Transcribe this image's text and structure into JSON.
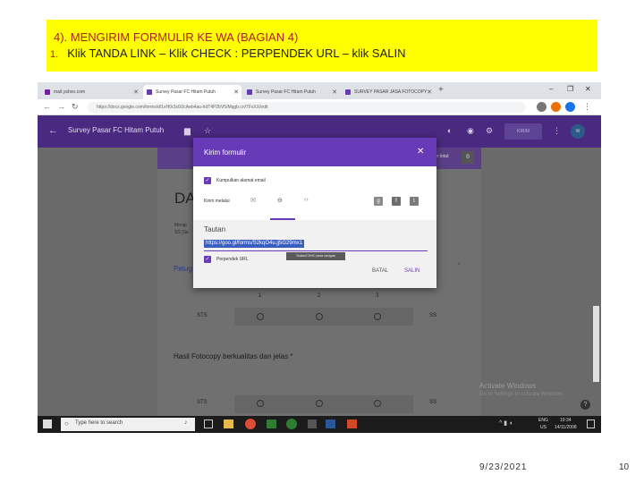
{
  "slide": {
    "heading_line1": "4). MENGIRIM FORMULIR KE WA (BAGIAN 4)",
    "list_number": "1.",
    "heading_line2": "Klik TANDA LINK – Klik CHECK : PERPENDEK URL – klik SALIN",
    "footer_date": "9/23/2021",
    "page_number": "10"
  },
  "browser": {
    "tabs": [
      {
        "label": "mail.yahoo.com",
        "active": false
      },
      {
        "label": "Survey Pasar FC Hitam Putuh",
        "active": true
      },
      {
        "label": "Survey Pasar FC Hitam Putuh",
        "active": false
      },
      {
        "label": "SURVEY PASAR JASA FOTOCOPY",
        "active": false
      }
    ],
    "tab_close": "✕",
    "new_tab": "+",
    "url": "https://docs.google.com/forms/d/1xH0r3s0lJcAeb4au-hdT4P2bV5/Mqgb.cn/7FsXX/edit"
  },
  "form": {
    "title": "Survey Pasar FC Hitam Putuh",
    "send_label": "KIRIM",
    "avatar_initials": "W",
    "total_label": "In total:",
    "total_value": "0",
    "section_title": "DA",
    "desc1": "Mengi",
    "desc2": "SS (Se",
    "question1": "Petug",
    "scale": [
      "1",
      "2",
      "3"
    ],
    "low_label": "STS",
    "high_label": "SS",
    "question2": "Hasil Fotocopy berkualitas dan jelas",
    "required_mark": "*",
    "activate_title": "Activate Windows",
    "activate_sub": "Go to Settings to activate Windows.",
    "help": "?"
  },
  "dialog": {
    "title": "Kirim formulir",
    "close": "✕",
    "collect_email": "Kumpulkan alamat email",
    "send_via": "Kirim melalui",
    "link_heading": "Tautan",
    "link_url": "https://goo.gl/forms/S2kqO4u.jj5G29mx1",
    "shorten": "Perpendek URL",
    "tooltip": "Tautan/CHHC pada navigasi",
    "cancel": "BATAL",
    "copy": "SALIN"
  },
  "taskbar": {
    "search_placeholder": "Type here to search",
    "lang": "ENG",
    "region": "US",
    "time": "19:34",
    "date": "14/11/2008"
  },
  "colors": {
    "header_bg": "#ffff00",
    "heading_red": "#b02020",
    "forms_purple": "#673ab7",
    "link_blue": "#3b5fc0",
    "taskbar": "#1b1b1b"
  }
}
